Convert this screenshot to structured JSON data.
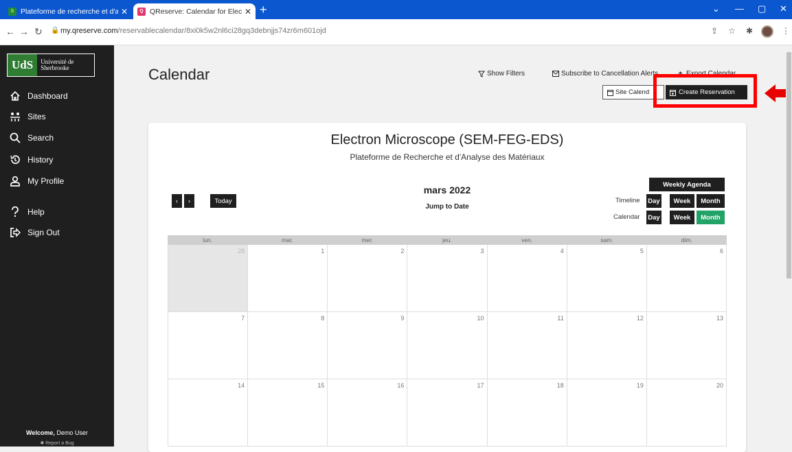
{
  "browser": {
    "tabs": [
      {
        "title": "Plateforme de recherche et d'ana",
        "favicon": "uds-favicon"
      },
      {
        "title": "QReserve: Calendar for Electron",
        "favicon": "qreserve-favicon"
      }
    ],
    "url_host": "my.qreserve.com",
    "url_path": "/reservablecalendar/8xi0k5w2nl6ci28gq3debnjjs74zr6m601ojd"
  },
  "sidebar": {
    "logo_mark": "UdS",
    "logo_name_1": "Université de",
    "logo_name_2": "Sherbrooke",
    "items": [
      {
        "label": "Dashboard",
        "icon": "home-icon"
      },
      {
        "label": "Sites",
        "icon": "sites-icon"
      },
      {
        "label": "Search",
        "icon": "search-icon"
      },
      {
        "label": "History",
        "icon": "history-icon"
      },
      {
        "label": "My Profile",
        "icon": "user-icon"
      },
      {
        "label": "Help",
        "icon": "help-icon"
      },
      {
        "label": "Sign Out",
        "icon": "sign-out-icon"
      }
    ],
    "welcome_prefix": "Welcome,",
    "welcome_user": "Demo User",
    "report_bug": "Report a Bug"
  },
  "header": {
    "title": "Calendar",
    "show_filters": "Show Filters",
    "subscribe": "Subscribe to Cancellation Alerts",
    "export": "Export Calendar",
    "site_calendar": "Site Calend",
    "create_reservation": "Create Reservation"
  },
  "calendar": {
    "resource_title": "Electron Microscope (SEM-FEG-EDS)",
    "resource_subtitle": "Plateforme de Recherche et d'Analyse des Matériaux",
    "prev": "‹",
    "next": "›",
    "today": "Today",
    "month_label": "mars 2022",
    "jump_to_date": "Jump to Date",
    "weekly_agenda": "Weekly Agenda",
    "timeline_label": "Timeline",
    "calendar_label": "Calendar",
    "view_day": "Day",
    "view_week": "Week",
    "view_month": "Month",
    "active_view": "calendar-month",
    "weekdays": [
      "lun.",
      "mar.",
      "mer.",
      "jeu.",
      "ven.",
      "sam.",
      "dim."
    ],
    "weeks": [
      [
        "28",
        "1",
        "2",
        "3",
        "4",
        "5",
        "6"
      ],
      [
        "7",
        "8",
        "9",
        "10",
        "11",
        "12",
        "13"
      ],
      [
        "14",
        "15",
        "16",
        "17",
        "18",
        "19",
        "20"
      ]
    ]
  },
  "colors": {
    "tabbar": "#0b57d0",
    "sidebar": "#1f1f1f",
    "accent_active": "#21a266",
    "highlight": "#ff0000"
  }
}
